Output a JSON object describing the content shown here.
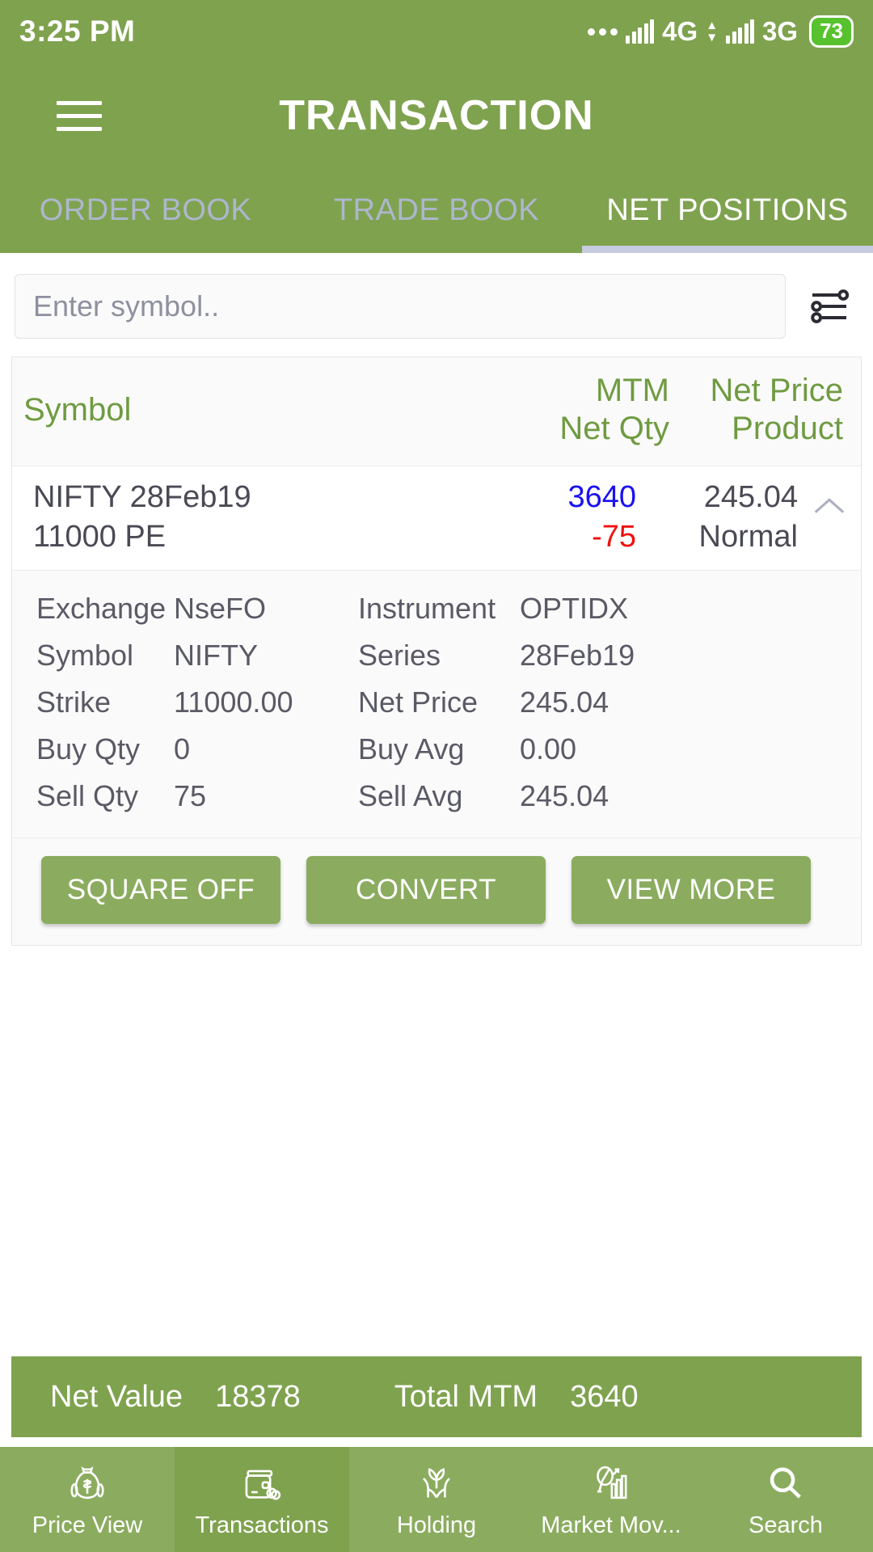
{
  "status_bar": {
    "time": "3:25 PM",
    "network_1": "4G",
    "network_2": "3G",
    "battery": "73"
  },
  "header": {
    "title": "TRANSACTION",
    "menu_icon": "hamburger-menu-icon"
  },
  "tabs": [
    {
      "label": "ORDER BOOK",
      "active": false
    },
    {
      "label": "TRADE BOOK",
      "active": false
    },
    {
      "label": "NET POSITIONS",
      "active": true
    }
  ],
  "search": {
    "placeholder": "Enter symbol..",
    "value": "",
    "filter_icon": "filter-sliders-icon"
  },
  "table": {
    "headers": {
      "symbol": "Symbol",
      "mtm": "MTM",
      "net_qty": "Net Qty",
      "net_price": "Net Price",
      "product": "Product"
    },
    "rows": [
      {
        "symbol_line1": "NIFTY 28Feb19",
        "symbol_line2": "11000 PE",
        "mtm": "3640",
        "net_qty": "-75",
        "net_price": "245.04",
        "product": "Normal",
        "mtm_color": "#1a10f0",
        "qty_color": "#f01010",
        "expanded": true,
        "details": [
          {
            "label1": "Exchange",
            "value1": "NseFO",
            "label2": "Instrument",
            "value2": "OPTIDX"
          },
          {
            "label1": "Symbol",
            "value1": "NIFTY",
            "label2": "Series",
            "value2": "28Feb19"
          },
          {
            "label1": "Strike",
            "value1": "11000.00",
            "label2": "Net Price",
            "value2": "245.04"
          },
          {
            "label1": "Buy Qty",
            "value1": "0",
            "label2": "Buy Avg",
            "value2": "0.00"
          },
          {
            "label1": "Sell Qty",
            "value1": "75",
            "label2": "Sell Avg",
            "value2": "245.04"
          }
        ],
        "actions": {
          "square_off": "SQUARE OFF",
          "convert": "CONVERT",
          "view_more": "VIEW MORE"
        }
      }
    ]
  },
  "summary": {
    "net_value_label": "Net Value",
    "net_value": "18378",
    "total_mtm_label": "Total MTM",
    "total_mtm": "3640"
  },
  "bottom_nav": [
    {
      "label": "Price View",
      "icon": "money-bag-icon",
      "active": false
    },
    {
      "label": "Transactions",
      "icon": "wallet-icon",
      "active": true
    },
    {
      "label": "Holding",
      "icon": "hands-plant-icon",
      "active": false
    },
    {
      "label": "Market Mov...",
      "icon": "magnifier-chart-icon",
      "active": false
    },
    {
      "label": "Search",
      "icon": "search-icon",
      "active": false
    }
  ],
  "colors": {
    "brand_green": "#7fa24f",
    "brand_green_light": "#8bac5f",
    "header_text_green": "#6f9b41",
    "tab_inactive": "#aeb6cd",
    "tab_indicator": "#c6cbe0",
    "positive_blue": "#1a10f0",
    "negative_red": "#f01010"
  }
}
